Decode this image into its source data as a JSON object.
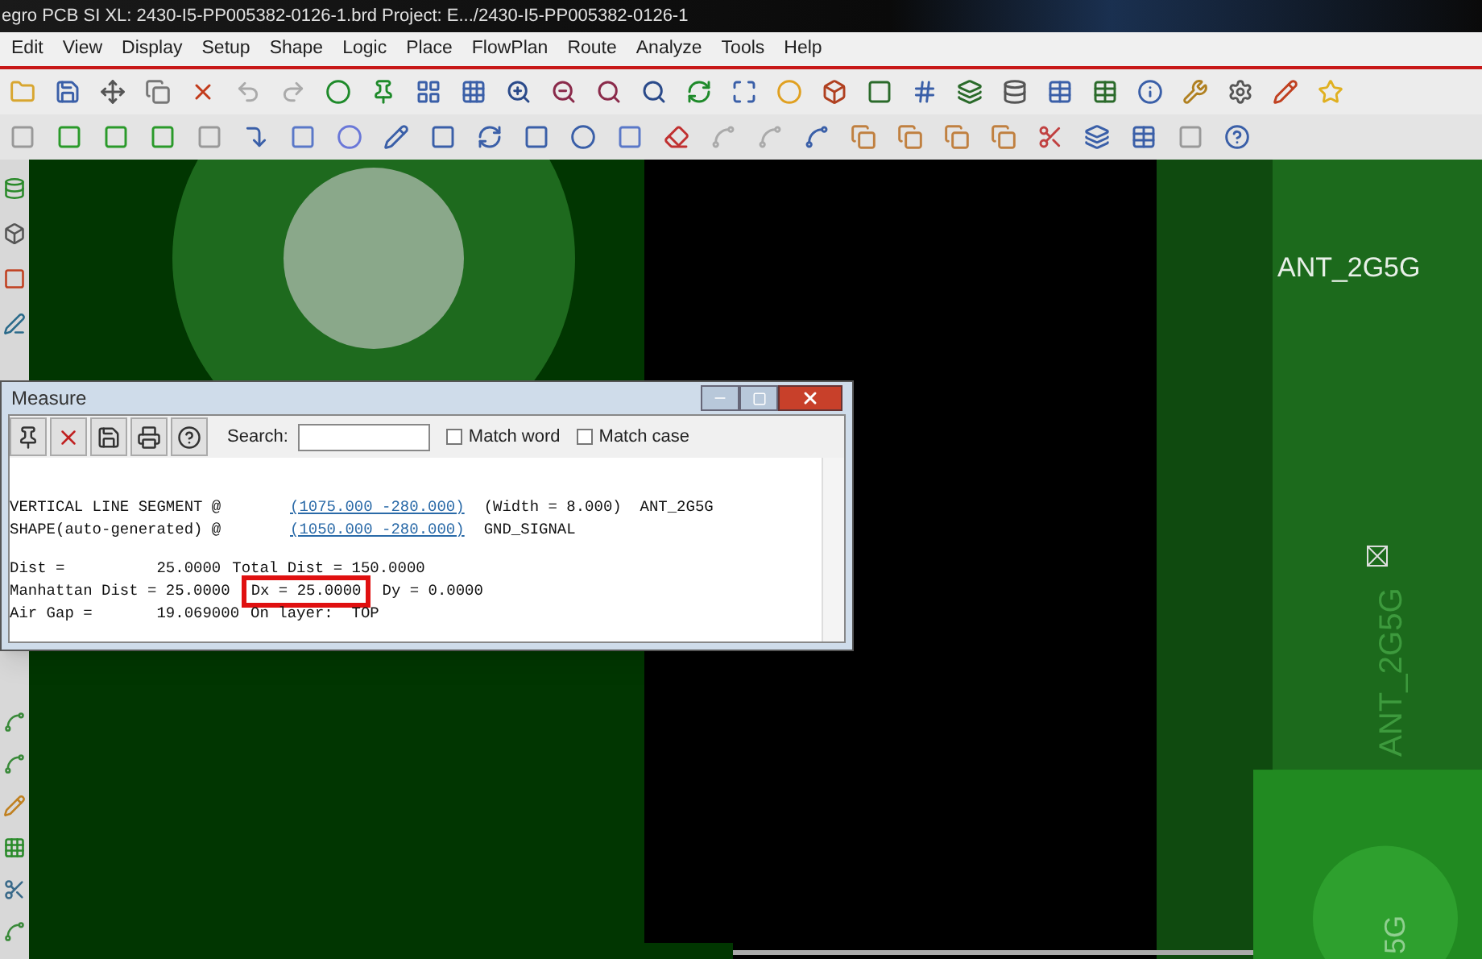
{
  "window": {
    "title": "egro PCB SI XL: 2430-I5-PP005382-0126-1.brd  Project: E.../2430-I5-PP005382-0126-1"
  },
  "menu": [
    "Edit",
    "View",
    "Display",
    "Setup",
    "Shape",
    "Logic",
    "Place",
    "FlowPlan",
    "Route",
    "Analyze",
    "Tools",
    "Help"
  ],
  "canvas": {
    "labels": [
      {
        "text": "ANT_2G5G",
        "kind": "flat"
      },
      {
        "text": "ANT_2G5G",
        "kind": "vertical"
      },
      {
        "text": "5G",
        "kind": "vertical-bottom"
      }
    ]
  },
  "measure": {
    "title": "Measure",
    "search": {
      "label": "Search:"
    },
    "options": [
      {
        "label": "Match word",
        "checked": false
      },
      {
        "label": "Match case",
        "checked": false
      }
    ],
    "records": [
      {
        "label": "VERTICAL LINE SEGMENT @",
        "coordinates": "(1075.000 -280.000)",
        "detail": "(Width = 8.000)  ANT_2G5G"
      },
      {
        "label": "SHAPE(auto-generated) @",
        "coordinates": "(1050.000 -280.000)",
        "detail": "GND_SIGNAL"
      }
    ],
    "summary": [
      {
        "segments": [
          {
            "text": "Dist =          25.0000",
            "highlighted": false
          },
          {
            "text": "Total Dist = 150.0000",
            "highlighted": false
          }
        ]
      },
      {
        "segments": [
          {
            "text": "Manhattan Dist = 25.0000",
            "highlighted": false
          },
          {
            "text": "Dx = 25.0000",
            "highlighted": true
          },
          {
            "text": "Dy = 0.0000",
            "highlighted": false
          }
        ]
      },
      {
        "segments": [
          {
            "text": "Air Gap =       19.069000",
            "highlighted": false
          },
          {
            "text": "On layer:  TOP",
            "highlighted": false
          }
        ]
      }
    ]
  }
}
